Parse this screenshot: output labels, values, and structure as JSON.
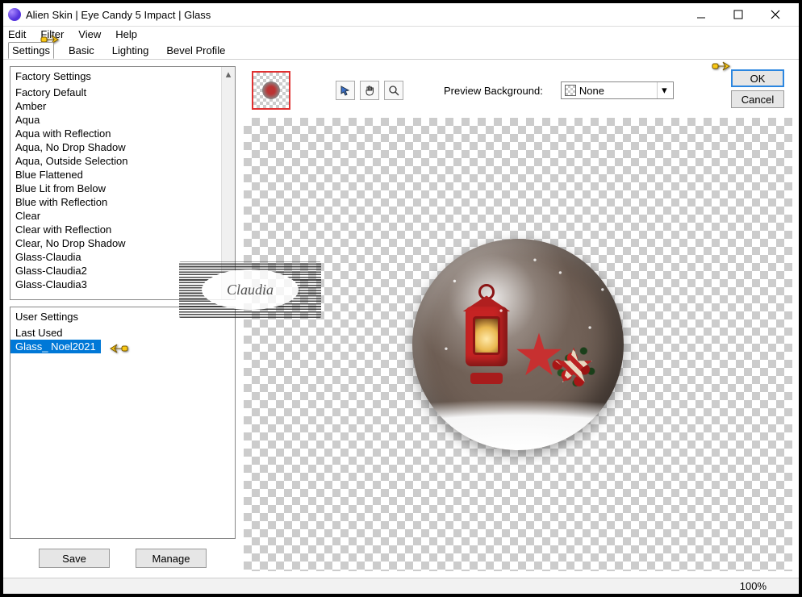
{
  "window": {
    "title": "Alien Skin | Eye Candy 5 Impact | Glass"
  },
  "menubar": [
    "Edit",
    "Filter",
    "View",
    "Help"
  ],
  "tabs": [
    "Settings",
    "Basic",
    "Lighting",
    "Bevel Profile"
  ],
  "active_tab": "Settings",
  "factory": {
    "header": "Factory Settings",
    "items": [
      "Factory Default",
      "Amber",
      "Aqua",
      "Aqua with Reflection",
      "Aqua, No Drop Shadow",
      "Aqua, Outside Selection",
      "Blue Flattened",
      "Blue Lit from Below",
      "Blue with Reflection",
      "Clear",
      "Clear with Reflection",
      "Clear, No Drop Shadow",
      "Glass-Claudia",
      "Glass-Claudia2",
      "Glass-Claudia3"
    ]
  },
  "user": {
    "header": "User Settings",
    "items": [
      "Last Used",
      "Glass_ Noel2021"
    ],
    "selected": "Glass_ Noel2021"
  },
  "buttons": {
    "save": "Save",
    "manage": "Manage",
    "ok": "OK",
    "cancel": "Cancel"
  },
  "preview_bg": {
    "label": "Preview Background:",
    "value": "None"
  },
  "status": {
    "zoom": "100%"
  },
  "watermark": "Claudia"
}
